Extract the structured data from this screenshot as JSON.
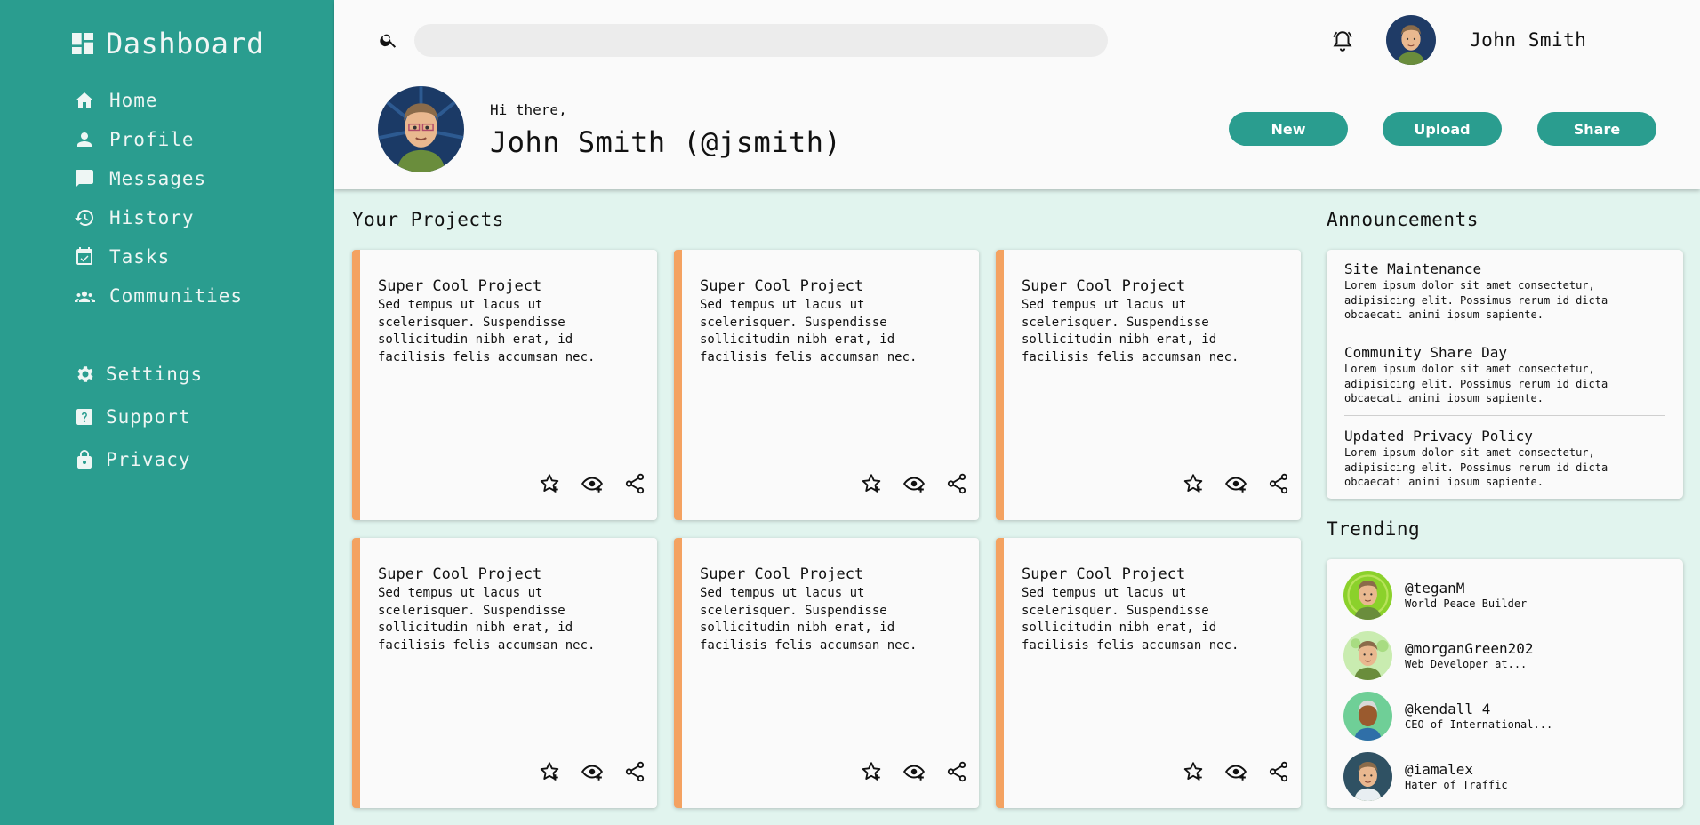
{
  "sidebar": {
    "brand": "Dashboard",
    "items": [
      {
        "label": "Home",
        "icon": "home-icon"
      },
      {
        "label": "Profile",
        "icon": "person-icon"
      },
      {
        "label": "Messages",
        "icon": "message-icon"
      },
      {
        "label": "History",
        "icon": "history-icon"
      },
      {
        "label": "Tasks",
        "icon": "calendar-check-icon"
      },
      {
        "label": "Communities",
        "icon": "group-icon"
      }
    ],
    "secondary": [
      {
        "label": "Settings",
        "icon": "gear-icon"
      },
      {
        "label": "Support",
        "icon": "help-icon"
      },
      {
        "label": "Privacy",
        "icon": "lock-icon"
      }
    ]
  },
  "header": {
    "search_placeholder": "",
    "user_name": "John Smith",
    "greeting": "Hi there,",
    "full_name": "John Smith (@jsmith)",
    "buttons": {
      "new": "New",
      "upload": "Upload",
      "share": "Share"
    }
  },
  "projects": {
    "title": "Your Projects",
    "cards": [
      {
        "title": "Super Cool Project",
        "desc": "Sed tempus ut lacus ut scelerisquer. Suspendisse sollicitudin nibh erat, id facilisis felis accumsan nec."
      },
      {
        "title": "Super Cool Project",
        "desc": "Sed tempus ut lacus ut scelerisquer. Suspendisse sollicitudin nibh erat, id facilisis felis accumsan nec."
      },
      {
        "title": "Super Cool Project",
        "desc": "Sed tempus ut lacus ut scelerisquer. Suspendisse sollicitudin nibh erat, id facilisis felis accumsan nec."
      },
      {
        "title": "Super Cool Project",
        "desc": "Sed tempus ut lacus ut scelerisquer. Suspendisse sollicitudin nibh erat, id facilisis felis accumsan nec."
      },
      {
        "title": "Super Cool Project",
        "desc": "Sed tempus ut lacus ut scelerisquer. Suspendisse sollicitudin nibh erat, id facilisis felis accumsan nec."
      },
      {
        "title": "Super Cool Project",
        "desc": "Sed tempus ut lacus ut scelerisquer. Suspendisse sollicitudin nibh erat, id facilisis felis accumsan nec."
      }
    ]
  },
  "announcements": {
    "title": "Announcements",
    "items": [
      {
        "title": "Site Maintenance",
        "body": "Lorem ipsum dolor sit amet consectetur, adipisicing elit. Possimus rerum id dicta obcaecati animi ipsum sapiente."
      },
      {
        "title": "Community Share Day",
        "body": "Lorem ipsum dolor sit amet consectetur, adipisicing elit. Possimus rerum id dicta obcaecati animi ipsum sapiente."
      },
      {
        "title": "Updated Privacy Policy",
        "body": "Lorem ipsum dolor sit amet consectetur, adipisicing elit. Possimus rerum id dicta obcaecati animi ipsum sapiente."
      }
    ]
  },
  "trending": {
    "title": "Trending",
    "items": [
      {
        "handle": "@teganM",
        "sub": "World Peace Builder"
      },
      {
        "handle": "@morganGreen202",
        "sub": "Web Developer at..."
      },
      {
        "handle": "@kendall_4",
        "sub": "CEO of International..."
      },
      {
        "handle": "@iamalex",
        "sub": "Hater of Traffic"
      }
    ]
  },
  "colors": {
    "sidebar": "#2a9d8f",
    "accent": "#f4a261",
    "background": "#e1f4ee",
    "card": "#fafafa"
  }
}
